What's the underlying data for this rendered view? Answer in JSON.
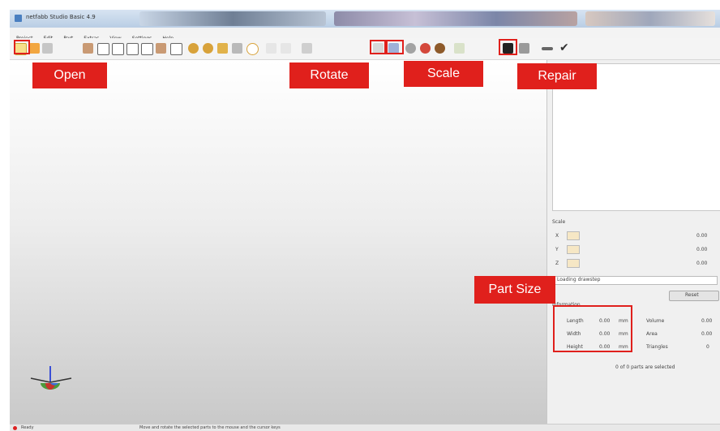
{
  "window": {
    "title": "netfabb Studio Basic 4.9"
  },
  "menu": [
    "Project",
    "Edit",
    "Part",
    "Extras",
    "View",
    "Settings",
    "Help"
  ],
  "callouts": {
    "open": "Open",
    "rotate": "Rotate",
    "scale": "Scale",
    "repair": "Repair",
    "part_size": "Part Size"
  },
  "panel": {
    "scale_label": "Scale",
    "axes": [
      "X",
      "Y",
      "Z"
    ],
    "scale_value": "0.00",
    "dropdown_label": "Loading drawstep",
    "reset_label": "Reset",
    "info_label": "Information",
    "size_rows": [
      {
        "label": "Length",
        "value": "0.00",
        "unit": "mm",
        "side_label": "Volume",
        "side_value": "0.00"
      },
      {
        "label": "Width",
        "value": "0.00",
        "unit": "mm",
        "side_label": "Area",
        "side_value": "0.00"
      },
      {
        "label": "Height",
        "value": "0.00",
        "unit": "mm",
        "side_label": "Triangles",
        "side_value": "0"
      }
    ],
    "selected_text": "0 of 0 parts are selected"
  },
  "status": {
    "left": "Ready",
    "center": "Move and rotate the selected parts to the mouse and the cursor keys"
  }
}
